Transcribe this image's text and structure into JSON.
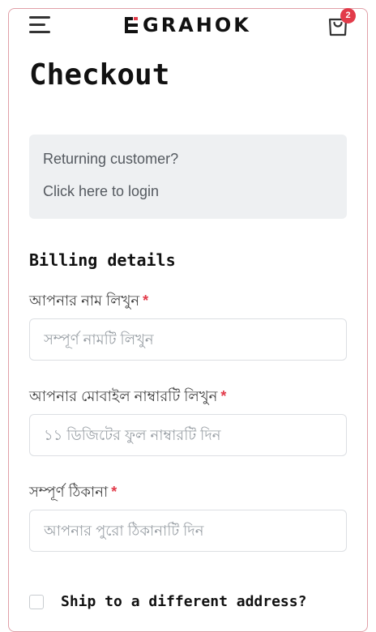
{
  "header": {
    "logo_text": "GRAHOK",
    "cart_count": "2",
    "icons": {
      "menu": "hamburger-menu-icon",
      "cart": "shopping-bag-icon"
    },
    "colors": {
      "accent": "#e23b4a",
      "text": "#111111"
    }
  },
  "page": {
    "title": "Checkout"
  },
  "returning_customer": {
    "prompt": "Returning customer?",
    "login_link": "Click here to login"
  },
  "billing": {
    "title": "Billing details",
    "required_marker": "*",
    "fields": [
      {
        "label": "আপনার নাম লিখুন",
        "placeholder": "সম্পূর্ণ নামটি লিখুন",
        "value": ""
      },
      {
        "label": "আপনার মোবাইল নাম্বারটি লিখুন",
        "placeholder": "১১ ডিজিটের ফুল নাম্বারটি দিন",
        "value": ""
      },
      {
        "label": "সম্পূর্ণ ঠিকানা",
        "placeholder": "আপনার পুরো ঠিকানাটি দিন",
        "value": ""
      }
    ]
  },
  "shipping": {
    "different_address_label": "Ship to a different address?",
    "checked": false
  }
}
